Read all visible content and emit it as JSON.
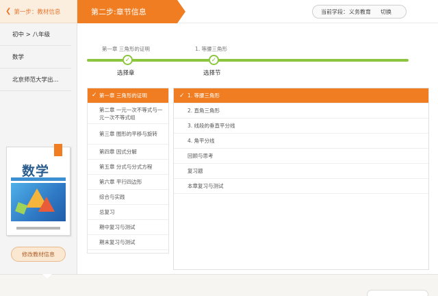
{
  "sidebar": {
    "step1_label": "第一步：教材信息",
    "grade": "初中 > 八年级",
    "subject": "数学",
    "publisher": "北京师范大学出...",
    "book_title": "数学",
    "edit_button": "修改教材信息"
  },
  "header": {
    "step2_label": "第二步:章节信息",
    "school_label": "当前学段：",
    "school_value": "义务教育",
    "switch_label": "切换"
  },
  "progress": {
    "chapter_caption": "第一章 三角形的证明",
    "section_caption": "1. 等腰三角形",
    "step1_label": "选择章",
    "step2_label": "选择节"
  },
  "chapters": [
    {
      "label": "第一章 三角形的证明",
      "selected": true
    },
    {
      "label": "第二章 一元一次不等式与一元一次不等式组",
      "selected": false
    },
    {
      "label": "第三章 图形的平移与旋转",
      "selected": false
    },
    {
      "label": "第四章 因式分解",
      "selected": false
    },
    {
      "label": "第五章 分式与分式方程",
      "selected": false
    },
    {
      "label": "第六章 平行四边形",
      "selected": false
    },
    {
      "label": "综合与实践",
      "selected": false
    },
    {
      "label": "总复习",
      "selected": false
    },
    {
      "label": "期中复习与测试",
      "selected": false
    },
    {
      "label": "期末复习与测试",
      "selected": false
    }
  ],
  "sections": [
    {
      "label": "1. 等腰三角形",
      "selected": true
    },
    {
      "label": "2. 直角三角形",
      "selected": false
    },
    {
      "label": "3. 线段的垂直平分线",
      "selected": false
    },
    {
      "label": "4. 角平分线",
      "selected": false
    },
    {
      "label": "回顾与思考",
      "selected": false
    },
    {
      "label": "复习题",
      "selected": false
    },
    {
      "label": "本章复习与测试",
      "selected": false
    }
  ],
  "icons": {
    "back": "chevron-left-icon",
    "check": "check-icon"
  },
  "colors": {
    "accent": "#f07d22",
    "progress": "#8cc63f"
  }
}
